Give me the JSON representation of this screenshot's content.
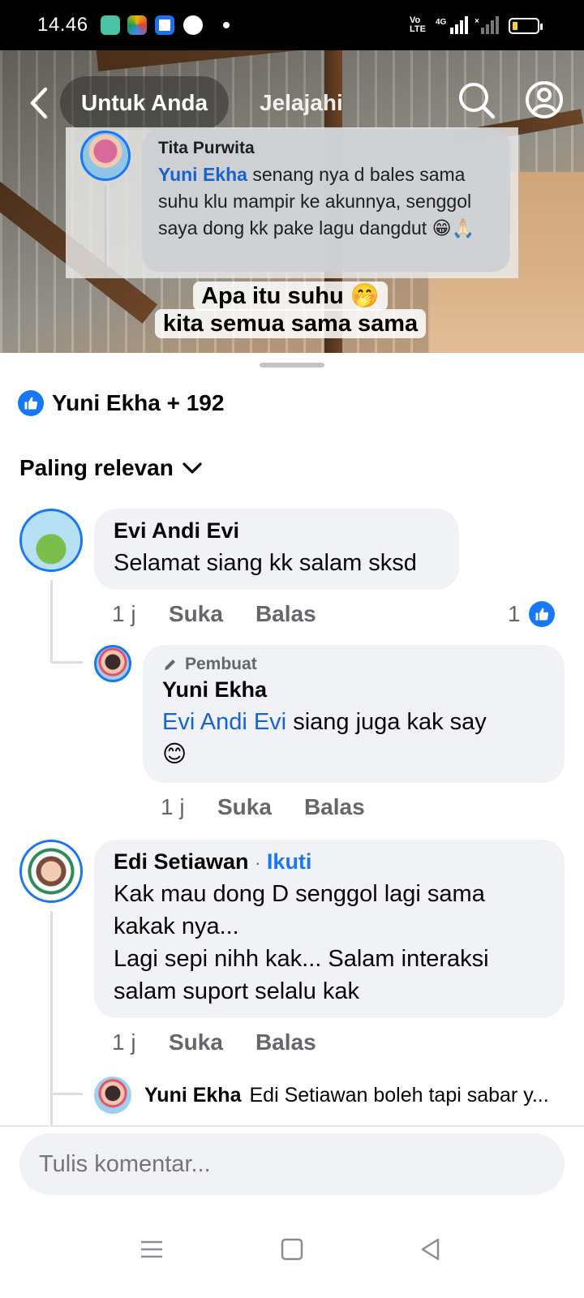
{
  "status_bar": {
    "time": "14.46",
    "network_label": "Vo LTE",
    "signal_label": "4G"
  },
  "top_nav": {
    "tabs": [
      {
        "label": "Untuk Anda",
        "active": true
      },
      {
        "label": "Jelajahi",
        "active": false
      }
    ]
  },
  "video_overlay": {
    "comment_name": "Tita Purwita",
    "comment_mention": "Yuni Ekha",
    "comment_text": " senang nya d bales sama suhu klu mampir ke akunnya, senggol saya dong kk pake lagu dangdut 😁🙏🏻",
    "caption_line1": "Apa itu suhu 🤭",
    "caption_line2": "kita semua sama sama"
  },
  "reactions": {
    "summary": "Yuni Ekha + 192"
  },
  "sort": {
    "label": "Paling relevan"
  },
  "comments": [
    {
      "name": "Evi Andi Evi",
      "text": "Selamat siang kk salam sksd",
      "time": "1 j",
      "like_label": "Suka",
      "reply_label": "Balas",
      "like_count": "1",
      "replies": [
        {
          "badge": "Pembuat",
          "name": "Yuni Ekha",
          "mention": "Evi Andi Evi",
          "text": " siang juga kak say",
          "emoji": "😊",
          "time": "1 j",
          "like_label": "Suka",
          "reply_label": "Balas"
        }
      ]
    },
    {
      "name": "Edi Setiawan",
      "follow_label": "Ikuti",
      "separator": "·",
      "text_line1": "Kak mau dong D senggol lagi sama kakak nya...",
      "text_line2": "Lagi sepi nihh kak... Salam interaksi salam suport selalu kak",
      "time": "1 j",
      "like_label": "Suka",
      "reply_label": "Balas",
      "reply_preview": {
        "name": "Yuni Ekha",
        "text": "Edi Setiawan boleh tapi sabar y..."
      }
    }
  ],
  "composer": {
    "placeholder": "Tulis komentar..."
  },
  "colors": {
    "accent": "#1877f2",
    "mention": "#1763cf",
    "bubble": "#f0f2f5",
    "muted": "#65676b"
  }
}
